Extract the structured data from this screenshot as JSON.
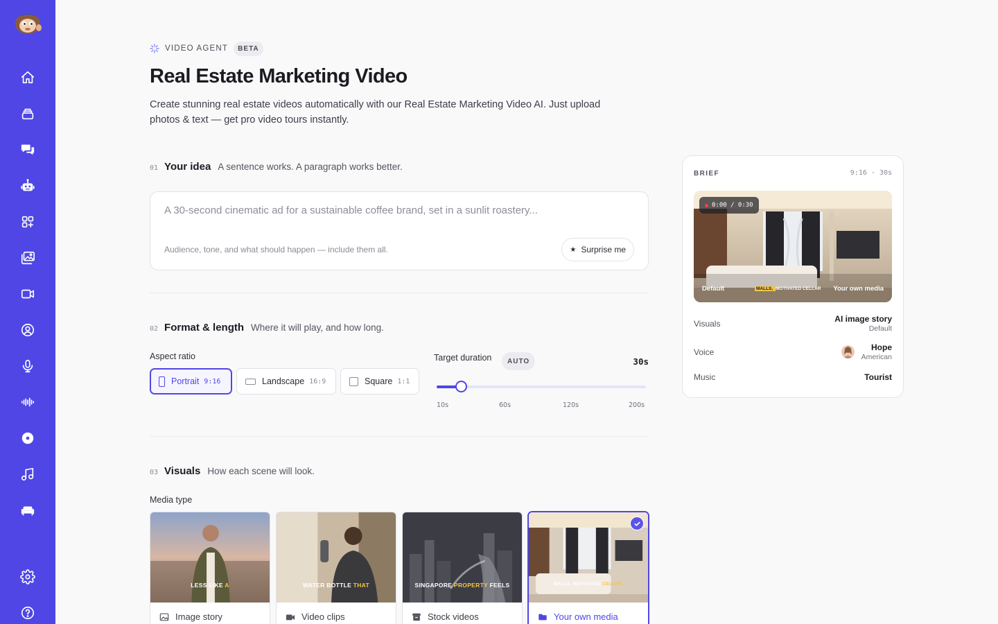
{
  "colors": {
    "accent": "#4f46e5",
    "sidebar": "#4f46e5",
    "background": "#f9f9fa"
  },
  "sidebar": {
    "logo": "monkey-mascot-logo",
    "items": [
      {
        "icon": "home-icon"
      },
      {
        "icon": "layers-icon"
      },
      {
        "icon": "chat-bubbles-icon"
      },
      {
        "icon": "robot-icon"
      },
      {
        "icon": "apps-grid-icon"
      },
      {
        "icon": "image-gallery-icon"
      },
      {
        "icon": "video-camera-icon"
      },
      {
        "icon": "user-circle-icon"
      },
      {
        "icon": "microphone-icon"
      },
      {
        "icon": "audio-wave-icon"
      },
      {
        "icon": "disc-icon"
      },
      {
        "icon": "music-note-icon"
      },
      {
        "icon": "sofa-icon"
      },
      {
        "icon": "gear-icon"
      },
      {
        "icon": "help-circle-icon"
      }
    ]
  },
  "header": {
    "eyebrow": "VIDEO AGENT",
    "badge": "BETA",
    "title": "Real Estate Marketing Video",
    "description": "Create stunning real estate videos automatically with our Real Estate Marketing Video AI. Just upload photos & text — get pro video tours instantly."
  },
  "idea": {
    "num": "01",
    "title": "Your idea",
    "subtitle": "A sentence works. A paragraph works better.",
    "placeholder": "A 30-second cinematic ad for a sustainable coffee brand, set in a sunlit roastery...",
    "value": "",
    "hint": "Audience, tone, and what should happen — include them all.",
    "surprise_label": "Surprise me"
  },
  "format": {
    "num": "02",
    "title": "Format & length",
    "subtitle": "Where it will play, and how long.",
    "aspect_label": "Aspect ratio",
    "aspect_options": [
      {
        "label": "Portrait",
        "ratio": "9:16",
        "selected": true
      },
      {
        "label": "Landscape",
        "ratio": "16:9",
        "selected": false
      },
      {
        "label": "Square",
        "ratio": "1:1",
        "selected": false
      }
    ],
    "duration_label": "Target duration",
    "duration_mode": "AUTO",
    "duration_value": "30s",
    "slider_fraction": 0.116,
    "ticks": [
      "10s",
      "60s",
      "120s",
      "200s"
    ]
  },
  "visuals": {
    "num": "03",
    "title": "Visuals",
    "subtitle": "How each scene will look.",
    "media_label": "Media type",
    "media_types": [
      {
        "label": "Image story",
        "icon": "image-icon",
        "caption_a": "LESS LIKE ",
        "caption_b": "A",
        "selected": false
      },
      {
        "label": "Video clips",
        "icon": "video-icon",
        "caption_a": "WATER BOTTLE ",
        "caption_b": "THAT",
        "selected": false
      },
      {
        "label": "Stock videos",
        "icon": "archive-box-icon",
        "caption_a": "SINGAPORE ",
        "caption_b": "PROPERTY",
        "caption_c": " FEELS",
        "selected": false
      },
      {
        "label": "Your own media",
        "icon": "folder-icon",
        "caption_a": "MALLS, MOTIVATED ",
        "caption_b": "CELLAR,",
        "selected": true
      }
    ]
  },
  "brief": {
    "label": "BRIEF",
    "meta": "9:16 · 30s",
    "timecode": "0:00 / 0:30",
    "video_caption_left": "Default",
    "video_caption_mid_a": "MALLS, ",
    "video_caption_mid_b": "MOTIVATED CELLAR",
    "video_caption_right": "Your own media",
    "rows": {
      "visuals_key": "Visuals",
      "visuals_value": "AI image story",
      "visuals_sub": "Default",
      "voice_key": "Voice",
      "voice_value": "Hope",
      "voice_sub": "American",
      "music_key": "Music",
      "music_value": "Tourist"
    }
  }
}
